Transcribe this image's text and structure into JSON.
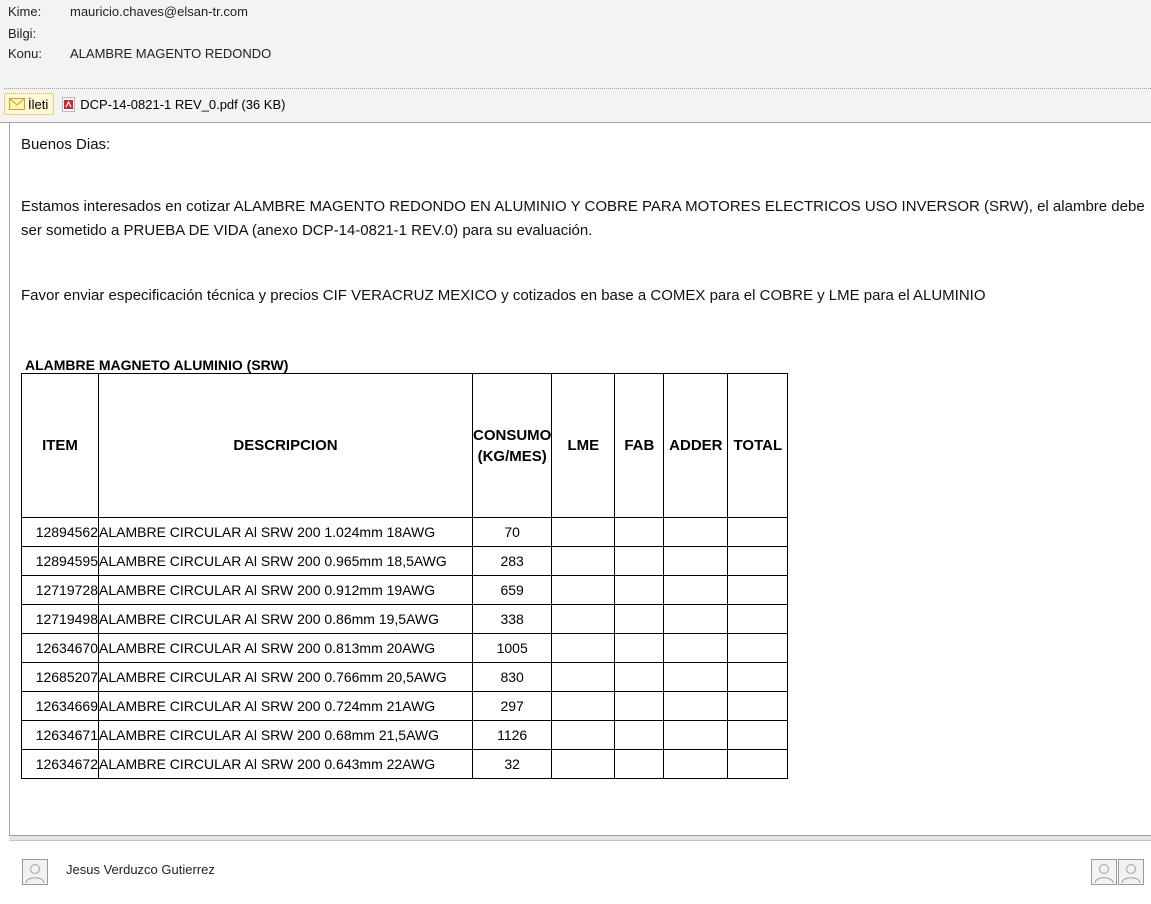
{
  "header": {
    "to_label": "Kime:",
    "to_value": "mauricio.chaves@elsan-tr.com",
    "cc_label": "Bilgi:",
    "subject_label": "Konu:",
    "subject_value": "ALAMBRE MAGENTO REDONDO",
    "message_tab_label": "İleti",
    "attachment_label": "DCP-14-0821-1 REV_0.pdf (36 KB)"
  },
  "body": {
    "greeting": "Buenos Dias:",
    "paragraph1": "Estamos interesados en cotizar ALAMBRE MAGENTO REDONDO EN ALUMINIO Y COBRE PARA MOTORES ELECTRICOS USO INVERSOR (SRW), el alambre debe ser sometido a PRUEBA DE VIDA (anexo DCP-14-0821-1 REV.0) para su evaluación.",
    "paragraph2": "Favor  enviar especificación técnica y precios CIF VERACRUZ MEXICO y cotizados en base a COMEX para el COBRE y LME para el ALUMINIO",
    "table_title": "ALAMBRE MAGNETO ALUMINIO (SRW)",
    "table_headers": [
      "ITEM",
      "DESCRIPCION",
      "CONSUMO (KG/MES)",
      "LME",
      "FAB",
      "ADDER",
      "TOTAL"
    ],
    "table_rows": [
      [
        "12894562",
        "ALAMBRE CIRCULAR Al SRW 200 1.024mm 18AWG",
        "70"
      ],
      [
        "12894595",
        "ALAMBRE CIRCULAR Al SRW 200 0.965mm 18,5AWG",
        "283"
      ],
      [
        "12719728",
        "ALAMBRE CIRCULAR Al SRW 200 0.912mm 19AWG",
        "659"
      ],
      [
        "12719498",
        "ALAMBRE CIRCULAR Al SRW 200 0.86mm 19,5AWG",
        "338"
      ],
      [
        "12634670",
        "ALAMBRE CIRCULAR Al SRW 200 0.813mm 20AWG",
        "1005"
      ],
      [
        "12685207",
        "ALAMBRE CIRCULAR Al SRW 200 0.766mm 20,5AWG",
        "830"
      ],
      [
        "12634669",
        "ALAMBRE CIRCULAR Al SRW 200 0.724mm 21AWG",
        "297"
      ],
      [
        "12634671",
        "ALAMBRE CIRCULAR Al SRW 200 0.68mm 21,5AWG",
        "1126"
      ],
      [
        "12634672",
        "ALAMBRE CIRCULAR Al SRW 200 0.643mm 22AWG",
        "32"
      ]
    ]
  },
  "footer": {
    "sender_name": "Jesus Verduzco Gutierrez"
  },
  "icons": {
    "message_tab": "envelope-icon",
    "attachment": "pdf-icon",
    "avatar": "person-icon"
  },
  "colors": {
    "header_bg": "#f3f3f3",
    "tab_active_bg": "#fff8d6",
    "pdf_red": "#d8262e"
  }
}
